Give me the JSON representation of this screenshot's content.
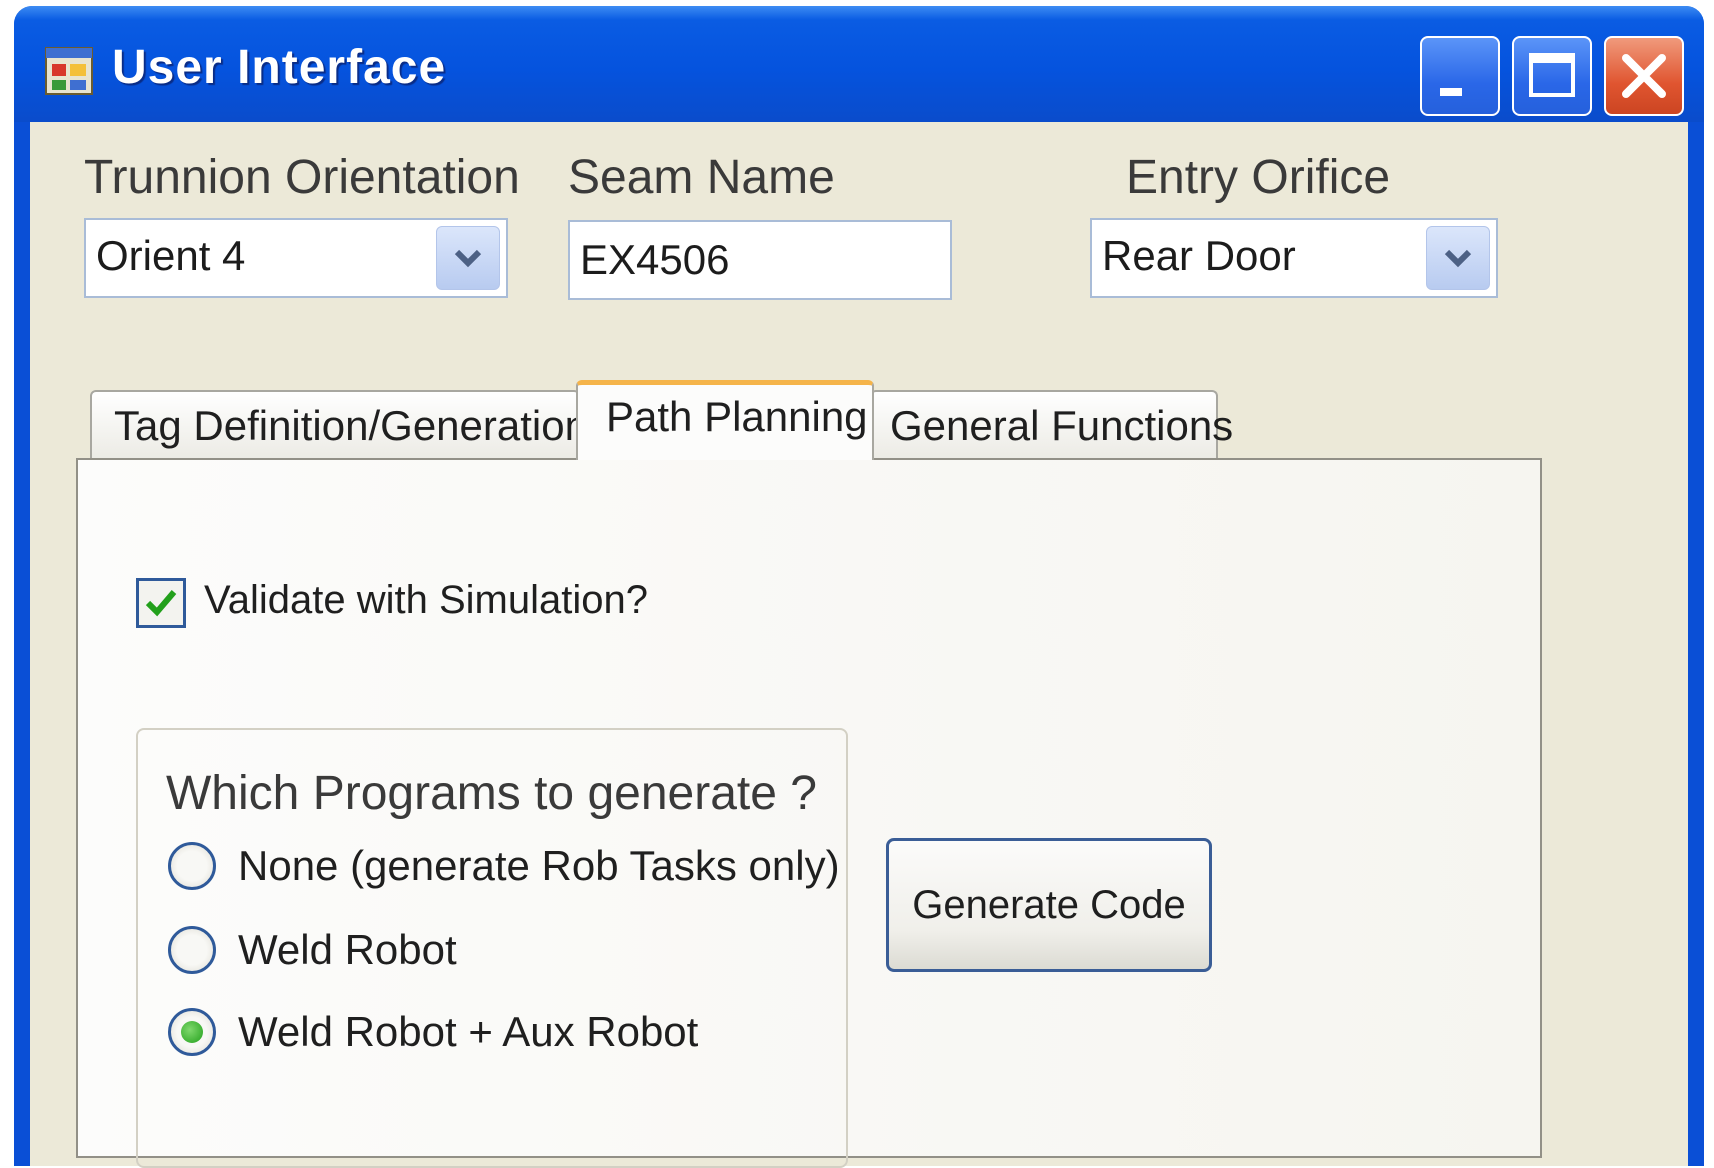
{
  "window": {
    "title": "User Interface",
    "icon": "app-window-icon",
    "controls": {
      "minimize_icon": "minimize-icon",
      "maximize_icon": "maximize-icon",
      "close_icon": "close-icon"
    }
  },
  "fields": {
    "trunnion": {
      "label": "Trunnion Orientation",
      "value": "Orient 4"
    },
    "seam": {
      "label": "Seam Name",
      "value": "EX4506"
    },
    "entry": {
      "label": "Entry Orifice",
      "value": "Rear Door"
    }
  },
  "tabs": [
    {
      "label": "Tag Definition/Generation",
      "active": false
    },
    {
      "label": "Path Planning",
      "active": true
    },
    {
      "label": "General Functions",
      "active": false
    }
  ],
  "path_planning": {
    "validate_label": "Validate with Simulation?",
    "validate_checked": true,
    "group_title": "Which Programs to generate ?",
    "options": [
      {
        "label": "None (generate Rob Tasks only)",
        "selected": false
      },
      {
        "label": "Weld Robot",
        "selected": false
      },
      {
        "label": "Weld Robot + Aux Robot",
        "selected": true
      }
    ],
    "generate_label": "Generate Code"
  },
  "colors": {
    "titlebar": "#0553de",
    "client_bg": "#ece9d8",
    "tab_highlight": "#f5b44a",
    "checkmark": "#22a01b",
    "close_button": "#e05530"
  }
}
